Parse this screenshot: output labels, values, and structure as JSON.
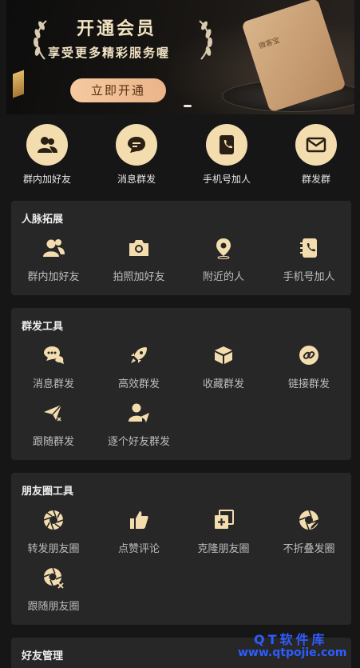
{
  "banner": {
    "title": "开通会员",
    "subtitle": "享受更多精彩服务喔",
    "button": "立即开通",
    "card_text": "微客宝"
  },
  "quick": [
    {
      "label": "群内加好友",
      "icon": "two-users-icon"
    },
    {
      "label": "消息群发",
      "icon": "chat-bubble-icon"
    },
    {
      "label": "手机号加人",
      "icon": "phone-book-icon"
    },
    {
      "label": "群发群",
      "icon": "envelope-icon"
    }
  ],
  "sections": {
    "network": {
      "title": "人脉拓展",
      "items": [
        {
          "label": "群内加好友",
          "icon": "users-icon"
        },
        {
          "label": "拍照加好友",
          "icon": "camera-icon"
        },
        {
          "label": "附近的人",
          "icon": "location-pin-icon"
        },
        {
          "label": "手机号加人",
          "icon": "phone-book-icon"
        }
      ]
    },
    "broadcast": {
      "title": "群发工具",
      "items": [
        {
          "label": "消息群发",
          "icon": "chat-bubbles-icon"
        },
        {
          "label": "高效群发",
          "icon": "rocket-icon"
        },
        {
          "label": "收藏群发",
          "icon": "box-icon"
        },
        {
          "label": "链接群发",
          "icon": "link-icon"
        },
        {
          "label": "跟随群发",
          "icon": "send-follow-icon"
        },
        {
          "label": "逐个好友群发",
          "icon": "user-send-icon"
        }
      ]
    },
    "moments": {
      "title": "朋友圈工具",
      "items": [
        {
          "label": "转发朋友圈",
          "icon": "aperture-icon"
        },
        {
          "label": "点赞评论",
          "icon": "thumbs-up-icon"
        },
        {
          "label": "克隆朋友圈",
          "icon": "clone-plus-icon"
        },
        {
          "label": "不折叠发圈",
          "icon": "aperture-edit-icon"
        },
        {
          "label": "跟随朋友圈",
          "icon": "aperture-shuffle-icon"
        }
      ]
    },
    "friends": {
      "title": "好友管理"
    }
  },
  "watermark": {
    "line1": "QT软件库",
    "line2": "www.qtpojie.com"
  },
  "colors": {
    "accent_gold": "#f3dcae",
    "background": "#161616",
    "panel": "#272727",
    "button_gradient_start": "#f6c9a0",
    "watermark": "#2f5cff"
  }
}
